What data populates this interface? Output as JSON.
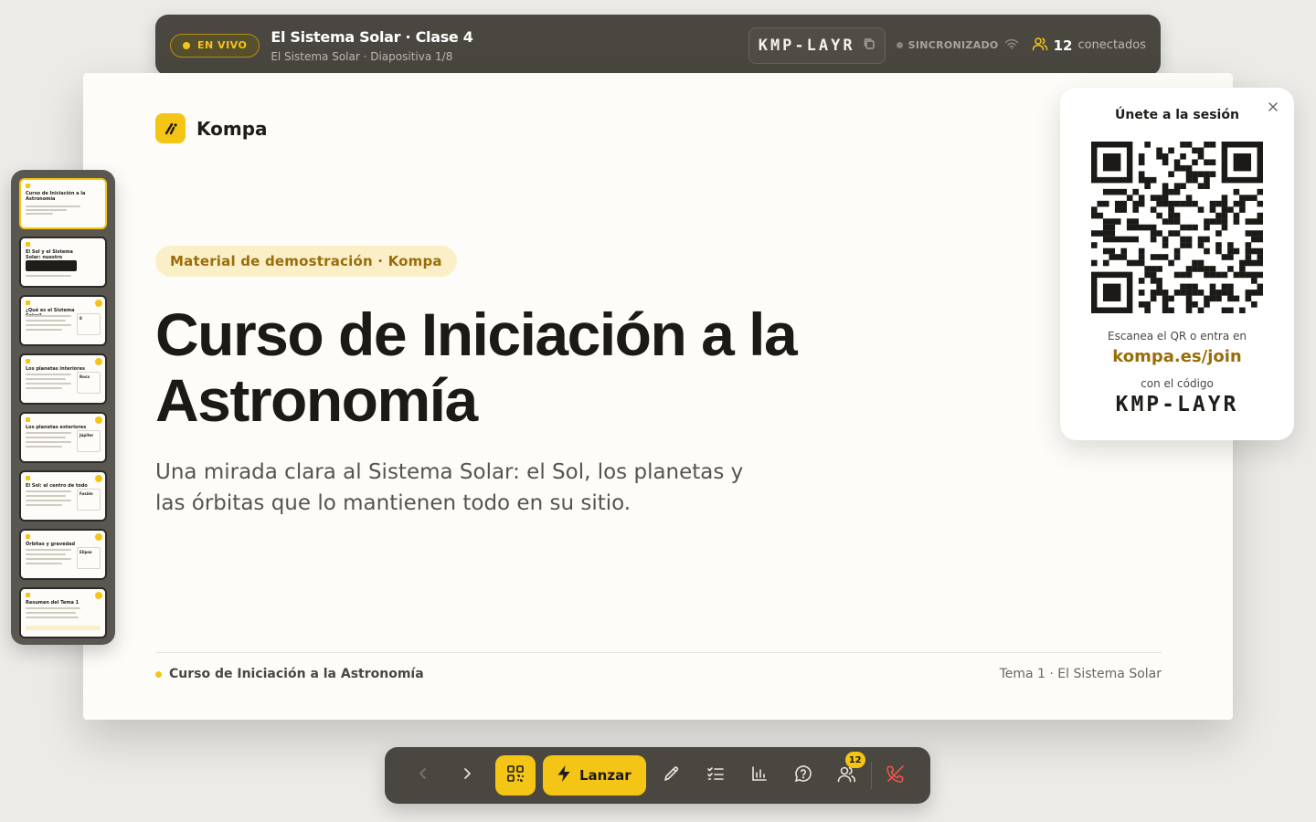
{
  "topbar": {
    "live_label": "EN VIVO",
    "title": "El Sistema Solar · Clase 4",
    "subtitle": "El Sistema Solar · Diapositiva 1/8",
    "session_code": "KMP-LAYR",
    "sync_label": "SINCRONIZADO",
    "connected_count": "12",
    "connected_label": "conectados"
  },
  "slide": {
    "brand": "Kompa",
    "tag": "Material de demostración · Kompa",
    "headline": "Curso de Iniciación a la Astronomía",
    "lede": "Una mirada clara al Sistema Solar: el Sol, los planetas y las órbitas que lo mantienen todo en su sitio.",
    "footer_left": "Curso de Iniciación a la Astronomía",
    "footer_right": "Tema 1 · El Sistema Solar"
  },
  "thumbnails": [
    {
      "title": "Curso de Iniciación a la Astronomía",
      "card": "",
      "active": true
    },
    {
      "title": "El Sol y el Sistema Solar: nuestro vecindario cósmico",
      "card": "",
      "active": false
    },
    {
      "title": "¿Qué es el Sistema Solar?",
      "card": "8",
      "active": false
    },
    {
      "title": "Los planetas interiores",
      "card": "Roca",
      "active": false
    },
    {
      "title": "Los planetas exteriores",
      "card": "Júpiter",
      "active": false
    },
    {
      "title": "El Sol: el centro de todo",
      "card": "Fusión",
      "active": false
    },
    {
      "title": "Órbitas y gravedad",
      "card": "Elipse",
      "active": false
    },
    {
      "title": "Resumen del Tema 1",
      "card": "",
      "active": false
    }
  ],
  "join_card": {
    "title": "Únete a la sesión",
    "hint": "Escanea el QR o entra en",
    "url": "kompa.es/join",
    "with_code": "con el código",
    "code": "KMP-LAYR"
  },
  "toolbar": {
    "launch_label": "Lanzar",
    "participants_badge": "12"
  },
  "colors": {
    "accent": "#f5c515",
    "dark_bar": "#4a4741",
    "slide_bg": "#fdfcf8",
    "end_call": "#e8564a"
  },
  "icons": [
    "chevron-left-icon",
    "chevron-right-icon",
    "qr-icon",
    "bolt-icon",
    "pencil-icon",
    "checklist-icon",
    "bar-chart-icon",
    "help-icon",
    "users-icon",
    "end-call-icon",
    "copy-icon",
    "wifi-icon",
    "close-icon"
  ]
}
